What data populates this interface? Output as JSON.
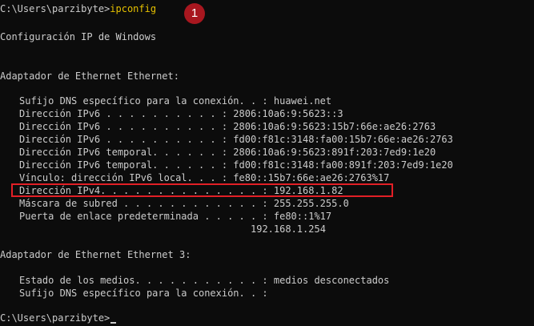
{
  "console": {
    "prompt1": "C:\\Users\\parzibyte>",
    "command": "ipconfig",
    "step_badge": "1",
    "header": "Configuración IP de Windows",
    "adapter1": {
      "title": "Adaptador de Ethernet Ethernet:",
      "lines": [
        "Sufijo DNS específico para la conexión. . : huawei.net",
        "Dirección IPv6 . . . . . . . . . . : 2806:10a6:9:5623::3",
        "Dirección IPv6 . . . . . . . . . . : 2806:10a6:9:5623:15b7:66e:ae26:2763",
        "Dirección IPv6 . . . . . . . . . . : fd00:f81c:3148:fa00:15b7:66e:ae26:2763",
        "Dirección IPv6 temporal. . . . . . : 2806:10a6:9:5623:891f:203:7ed9:1e20",
        "Dirección IPv6 temporal. . . . . . : fd00:f81c:3148:fa00:891f:203:7ed9:1e20",
        "Vínculo: dirección IPv6 local. . . : fe80::15b7:66e:ae26:2763%17",
        "Dirección IPv4. . . . . . . . . . . . . . : 192.168.1.82",
        "Máscara de subred . . . . . . . . . . . . : 255.255.255.0",
        "Puerta de enlace predeterminada . . . . . : fe80::1%17"
      ],
      "gateway_line2": "192.168.1.254"
    },
    "adapter2": {
      "title": "Adaptador de Ethernet Ethernet 3:",
      "lines": [
        "Estado de los medios. . . . . . . . . . . : medios desconectados",
        "Sufijo DNS específico para la conexión. . :"
      ]
    },
    "prompt2": "C:\\Users\\parzibyte>"
  },
  "colors": {
    "background": "#0c0c0c",
    "text": "#cccccc",
    "command": "#e5c000",
    "highlight_border": "#e21f26",
    "badge": "#a8171f"
  }
}
